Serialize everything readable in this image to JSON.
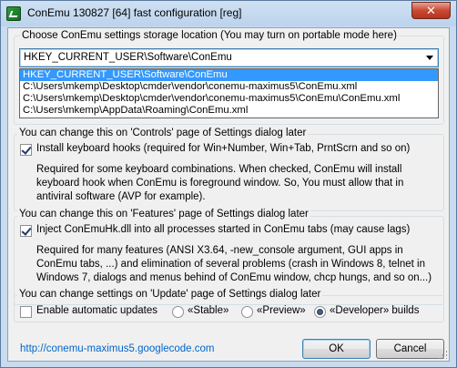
{
  "window": {
    "title": "ConEmu 130827 [64] fast configuration [reg]",
    "close_label": "✕"
  },
  "storage": {
    "label": "Choose ConEmu settings storage location (You may turn on portable mode here)",
    "selected": "HKEY_CURRENT_USER\\Software\\ConEmu",
    "options": [
      "HKEY_CURRENT_USER\\Software\\ConEmu",
      "C:\\Users\\mkemp\\Desktop\\cmder\\vendor\\conemu-maximus5\\ConEmu.xml",
      "C:\\Users\\mkemp\\Desktop\\cmder\\vendor\\conemu-maximus5\\ConEmu\\ConEmu.xml",
      "C:\\Users\\mkemp\\AppData\\Roaming\\ConEmu.xml"
    ]
  },
  "controls": {
    "label": "You can change this on 'Controls' page of Settings dialog later",
    "checkbox_label": "Install keyboard hooks (required for Win+Number, Win+Tab, PrntScrn and so on)",
    "checked": true,
    "description": "Required for some keyboard combinations. When checked, ConEmu will install keyboard hook when ConEmu is foreground window. So, You must allow that in antiviral software (AVP for example)."
  },
  "features": {
    "label": "You can change this on 'Features' page of Settings dialog later",
    "checkbox_label": "Inject ConEmuHk.dll into all processes started in ConEmu tabs (may cause lags)",
    "checked": true,
    "description": "Required for many features (ANSI X3.64, -new_console argument, GUI apps in ConEmu tabs, ...) and elimination of several problems (crash in Windows 8, telnet in Windows 7, dialogs and menus behind of ConEmu window, chcp hungs, and so on...)"
  },
  "update": {
    "label": "You can change settings on 'Update' page of Settings dialog later",
    "auto_label": "Enable automatic updates",
    "auto_checked": false,
    "radio_stable": "«Stable»",
    "radio_preview": "«Preview»",
    "radio_developer": "«Developer» builds",
    "selected_channel": "Developer"
  },
  "footer": {
    "link": "http://conemu-maximus5.googlecode.com",
    "ok_label": "OK",
    "cancel_label": "Cancel"
  }
}
